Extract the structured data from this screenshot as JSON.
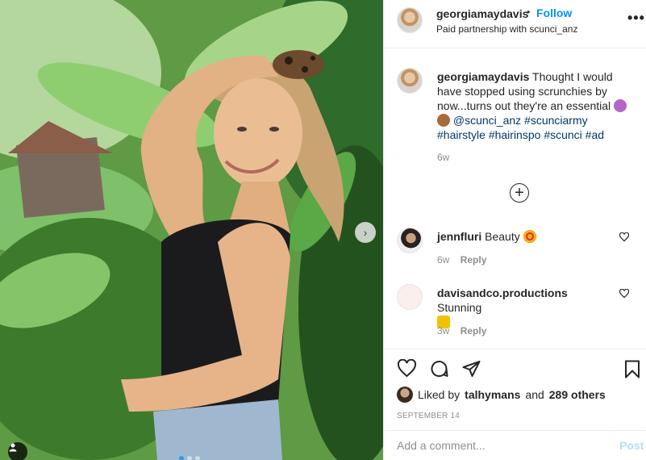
{
  "post": {
    "author": "georgiamaydavis",
    "dot": "•",
    "follow_label": "Follow",
    "partnership_prefix": "Paid partnership with",
    "partner": "scunci_anz",
    "more": "•••"
  },
  "caption": {
    "user": "georgiamaydavis",
    "text_1": "Thought I would have stopped using scrunchies by now...turns out they're an essential",
    "mention": "@scunci_anz",
    "hashtags": [
      "#scunciarmy",
      "#hairstyle",
      "#hairinspo",
      "#scunci",
      "#ad"
    ],
    "time": "6w"
  },
  "comments": [
    {
      "user": "jennfluri",
      "text": "Beauty",
      "time": "6w",
      "reply": "Reply"
    },
    {
      "user": "davisandco.productions",
      "text": "Stunning",
      "time": "3w",
      "reply": "Reply"
    }
  ],
  "likes": {
    "prefix": "Liked by",
    "user": "talhymans",
    "and": "and",
    "others": "289 others"
  },
  "date": "SEPTEMBER 14",
  "comment_box": {
    "placeholder": "Add a comment...",
    "post_label": "Post"
  },
  "photo": {
    "next_arrow": "›",
    "carousel_index": 1,
    "carousel_count": 3
  },
  "colors": {
    "link": "#00376b",
    "follow": "#0095f6",
    "post_disabled": "#b2dffc",
    "muted": "#8e8e8e"
  },
  "icons": [
    "heart-icon",
    "comment-icon",
    "share-icon",
    "bookmark-icon",
    "plus-circle-icon",
    "user-tag-icon",
    "chevron-right-icon",
    "more-icon"
  ]
}
